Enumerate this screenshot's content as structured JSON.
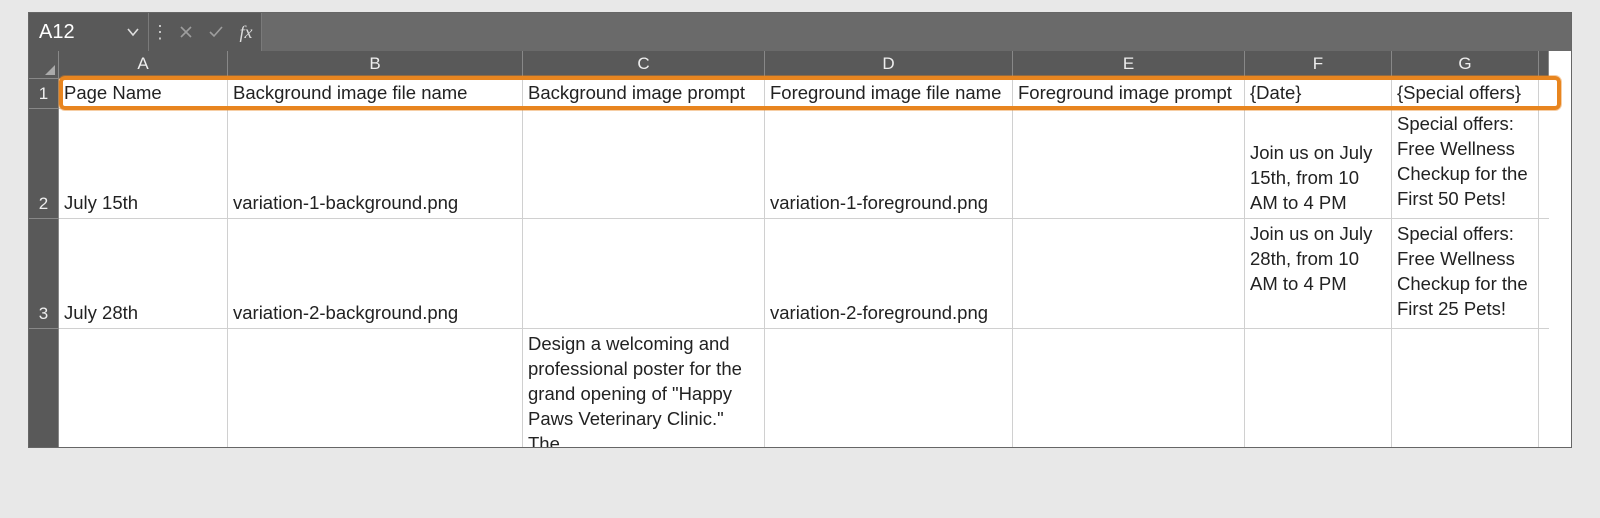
{
  "formula_bar": {
    "cell_ref": "A12",
    "formula_value": "",
    "fx_label": "fx"
  },
  "columns": [
    "A",
    "B",
    "C",
    "D",
    "E",
    "F",
    "G"
  ],
  "row_numbers": [
    "1",
    "2",
    "3"
  ],
  "headers": {
    "A": "Page Name",
    "B": "Background image file name",
    "C": "Background image prompt",
    "D": "Foreground image file name",
    "E": "Foreground image prompt",
    "F": "{Date}",
    "G": "{Special offers}"
  },
  "rows": [
    {
      "A": "July 15th",
      "B": "variation-1-background.png",
      "C": "",
      "D": "variation-1-foreground.png",
      "E": "",
      "F": "Join us on July 15th, from 10 AM to 4 PM",
      "G": "Special offers: Free Wellness Checkup for the First 50 Pets!"
    },
    {
      "A": "July 28th",
      "B": "variation-2-background.png",
      "C": "",
      "D": "variation-2-foreground.png",
      "E": "",
      "F": "Join us on July 28th, from 10 AM to 4 PM",
      "G": "Special offers: Free Wellness Checkup for the First 25 Pets!"
    }
  ],
  "row4": {
    "C": "Design a welcoming and professional poster for the grand opening of \"Happy Paws Veterinary Clinic.\" The"
  }
}
